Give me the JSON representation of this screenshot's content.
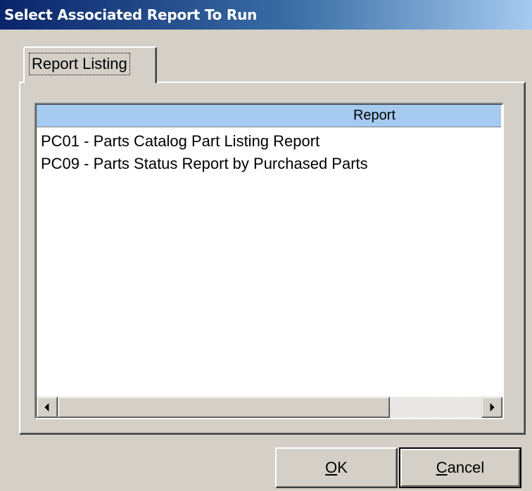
{
  "window": {
    "title": "Select Associated Report To Run"
  },
  "tabs": [
    {
      "label": "Report Listing",
      "active": true
    }
  ],
  "grid": {
    "columns": [
      "Report"
    ],
    "rows": [
      "PC01 - Parts Catalog Part Listing Report",
      "PC09 - Parts Status Report by Purchased Parts"
    ],
    "header_color": "#a6caf0"
  },
  "buttons": {
    "ok": {
      "accel": "O",
      "rest": "K"
    },
    "cancel": {
      "accel": "C",
      "rest": "ancel"
    }
  },
  "colors": {
    "face": "#d4d0c8",
    "title_start": "#0a246a",
    "title_end": "#a6caf0"
  },
  "icons": {
    "scroll_left": "arrow-left-icon",
    "scroll_right": "arrow-right-icon"
  }
}
